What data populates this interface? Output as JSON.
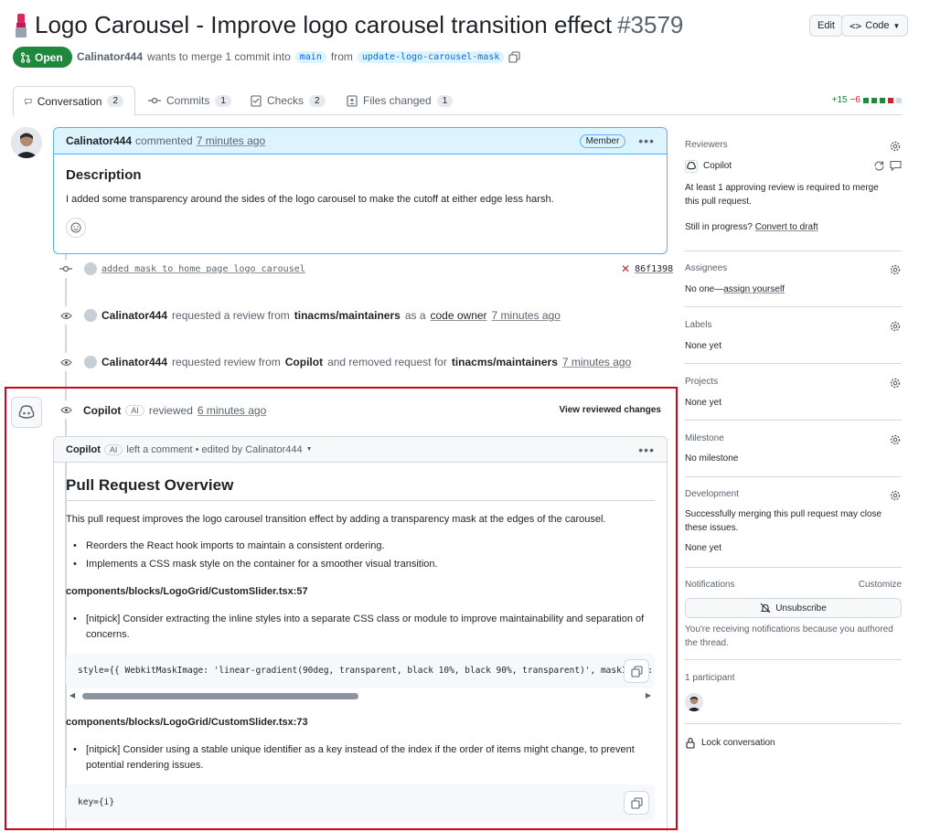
{
  "header": {
    "title": "Logo Carousel - Improve logo carousel transition effect",
    "number": "#3579",
    "edit_label": "Edit",
    "code_label": "Code",
    "status": "Open",
    "author": "Calinator444",
    "merge_text": "wants to merge 1 commit into",
    "base_branch": "main",
    "from_text": "from",
    "head_branch": "update-logo-carousel-mask"
  },
  "tabs": [
    {
      "label": "Conversation",
      "count": "2"
    },
    {
      "label": "Commits",
      "count": "1"
    },
    {
      "label": "Checks",
      "count": "2"
    },
    {
      "label": "Files changed",
      "count": "1"
    }
  ],
  "diffstat": {
    "additions": "+15",
    "deletions": "−6"
  },
  "comment": {
    "author": "Calinator444",
    "action": "commented",
    "time": "7 minutes ago",
    "badge": "Member",
    "heading": "Description",
    "body": "I added some transparency around the sides of the logo carousel to make the cutoff at either edge less harsh."
  },
  "commit": {
    "message": "added mask to home page logo carousel",
    "sha": "86f1398"
  },
  "events": [
    {
      "actor": "Calinator444",
      "t1": "requested a review from",
      "target": "tinacms/maintainers",
      "t2": "as a",
      "link": "code owner",
      "time": "7 minutes ago"
    },
    {
      "actor": "Calinator444",
      "t1": "requested review from",
      "target": "Copilot",
      "t2": "and removed request for",
      "target2": "tinacms/maintainers",
      "time": "7 minutes ago"
    }
  ],
  "review": {
    "reviewer": "Copilot",
    "ai_badge": "AI",
    "action": "reviewed",
    "time": "6 minutes ago",
    "view_changes": "View reviewed changes",
    "head_author": "Copilot",
    "head_text": "left a comment • edited by Calinator444",
    "overview_title": "Pull Request Overview",
    "overview_body": "This pull request improves the logo carousel transition effect by adding a transparency mask at the edges of the carousel.",
    "overview_bullets": [
      "Reorders the React hook imports to maintain a consistent ordering.",
      "Implements a CSS mask style on the container for a smoother visual transition."
    ],
    "file1": "components/blocks/LogoGrid/CustomSlider.tsx:57",
    "file1_bullet": "[nitpick] Consider extracting the inline styles into a separate CSS class or module to improve maintainability and separation of concerns.",
    "code1": "style={{ WebkitMaskImage: 'linear-gradient(90deg, transparent, black 10%, black 90%, transparent)', maskImage: 'linear-gr",
    "file2": "components/blocks/LogoGrid/CustomSlider.tsx:73",
    "file2_bullet": "[nitpick] Consider using a stable unique identifier as a key instead of the index if the order of items might change, to prevent potential rendering issues.",
    "code2": "key={i}"
  },
  "sidebar": {
    "reviewers_title": "Reviewers",
    "reviewer_name": "Copilot",
    "reviewers_note": "At least 1 approving review is required to merge this pull request.",
    "progress_text": "Still in progress?",
    "progress_link": "Convert to draft",
    "assignees_title": "Assignees",
    "assignees_none": "No one—",
    "assignees_link": "assign yourself",
    "labels_title": "Labels",
    "labels_value": "None yet",
    "projects_title": "Projects",
    "projects_value": "None yet",
    "milestone_title": "Milestone",
    "milestone_value": "No milestone",
    "development_title": "Development",
    "development_text": "Successfully merging this pull request may close these issues.",
    "development_value": "None yet",
    "notifications_title": "Notifications",
    "customize": "Customize",
    "unsubscribe": "Unsubscribe",
    "notifications_note": "You're receiving notifications because you authored the thread.",
    "participants": "1 participant",
    "lock": "Lock conversation"
  }
}
